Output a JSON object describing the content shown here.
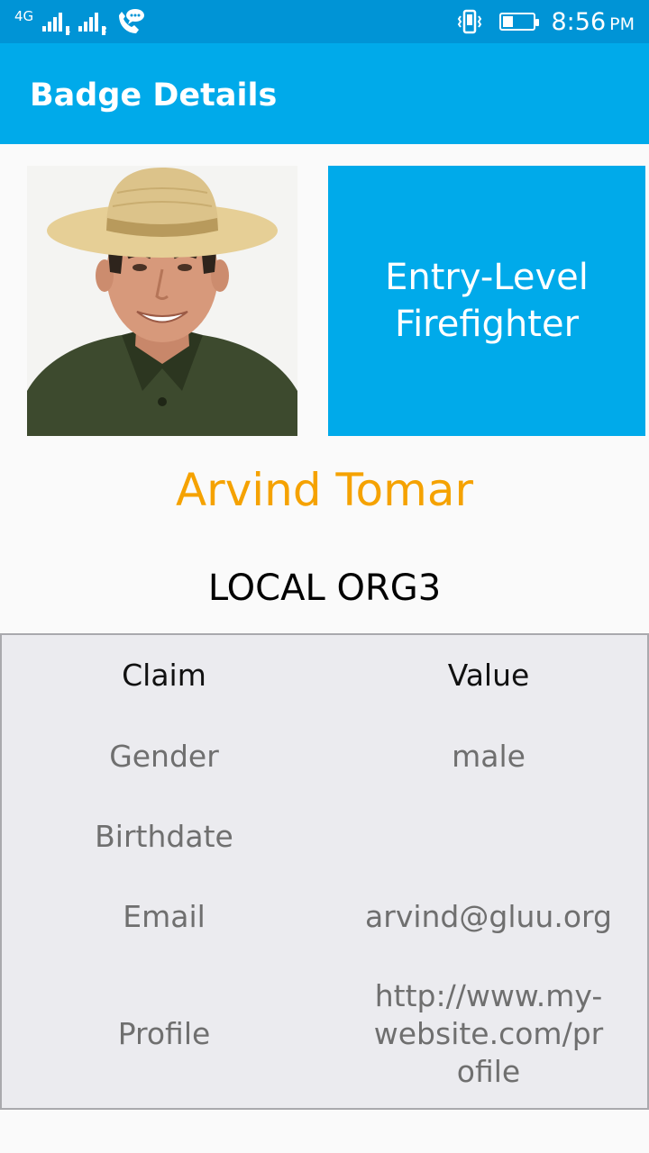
{
  "status_bar": {
    "network": "4G",
    "sim1": "1",
    "sim2": "2",
    "time": "8:56",
    "ampm": "PM",
    "battery_level": 0.35
  },
  "app_bar": {
    "title": "Badge Details"
  },
  "badge": {
    "title": "Entry-Level Firefighter"
  },
  "person": {
    "name": "Arvind Tomar",
    "org": "LOCAL ORG3"
  },
  "claims": {
    "headers": {
      "claim": "Claim",
      "value": "Value"
    },
    "rows": [
      {
        "claim": "Gender",
        "value": "male"
      },
      {
        "claim": "Birthdate",
        "value": ""
      },
      {
        "claim": "Email",
        "value": "arvind@gluu.org"
      },
      {
        "claim": "Profile",
        "value": "http://www.my-website.com/profile"
      }
    ]
  },
  "colors": {
    "status_bar": "#0094d6",
    "primary": "#00aaea",
    "name_accent": "#f5a200",
    "table_bg": "#ebebef"
  }
}
